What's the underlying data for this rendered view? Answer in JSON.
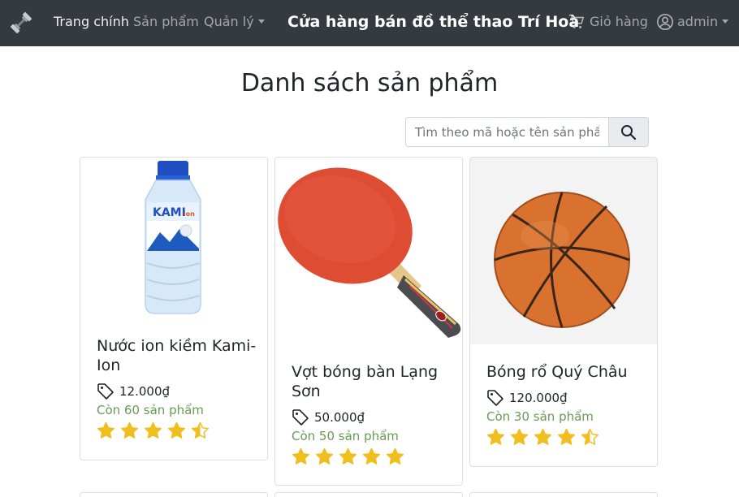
{
  "navbar": {
    "home": "Trang chính",
    "products": "Sản phẩm",
    "manage": "Quản lý",
    "store_title": "Cửa hàng bán đồ thể thao Trí Hoà",
    "cart": "Giỏ hàng",
    "user": "admin"
  },
  "page": {
    "title": "Danh sách sản phẩm"
  },
  "search": {
    "placeholder": "Tìm theo mã hoặc tên sản phẩm"
  },
  "products": [
    {
      "name": "Nước ion kiềm Kami-Ion",
      "price": "12.000₫",
      "stock": "Còn 60 sản phẩm",
      "rating": 4.5
    },
    {
      "name": "Vợt bóng bàn Lạng Sơn",
      "price": "50.000₫",
      "stock": "Còn 50 sản phẩm",
      "rating": 5
    },
    {
      "name": "Bóng rổ Quý Châu",
      "price": "120.000₫",
      "stock": "Còn 30 sản phẩm",
      "rating": 4.5
    }
  ],
  "colors": {
    "navbar": "#343a40",
    "stock": "#6a9b53",
    "star": "#f0bf1f"
  },
  "icons": {
    "brand": "dumbbell-icon",
    "cart": "cart-icon",
    "user": "user-circle-icon",
    "search": "search-icon",
    "price": "tag-icon"
  }
}
